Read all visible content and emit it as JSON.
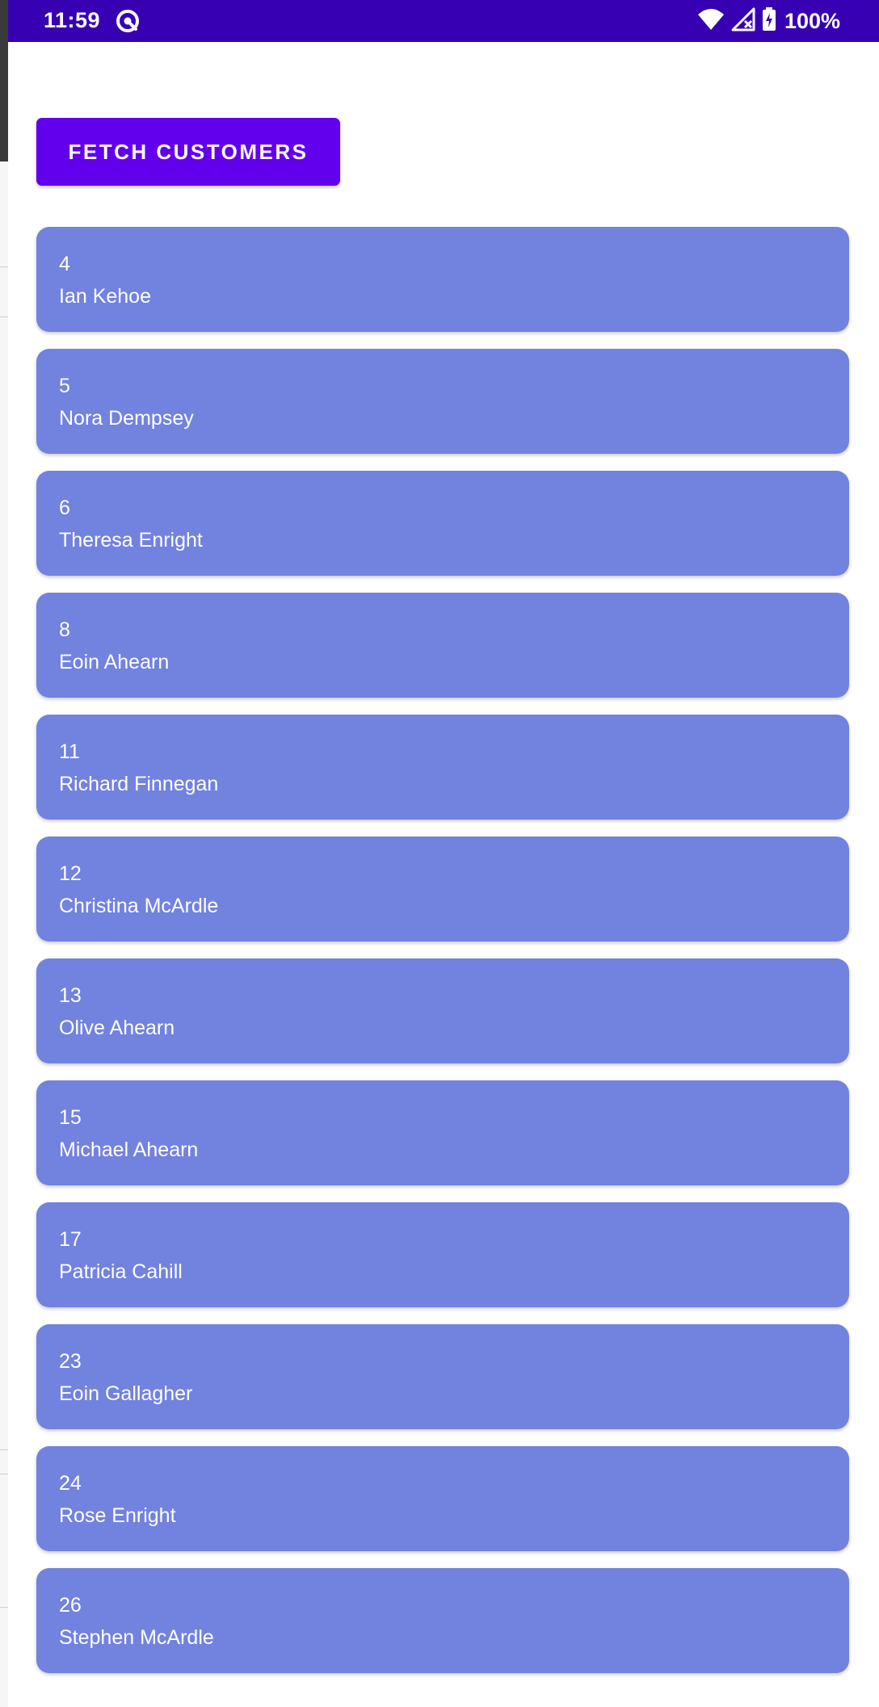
{
  "status_bar": {
    "time": "11:59",
    "left_icon": "sync-icon",
    "wifi_icon": "wifi-icon",
    "signal_icon": "cell-signal-no-service-icon",
    "battery_icon": "battery-charging-icon",
    "battery_text": "100%",
    "background_color": "#3700b3"
  },
  "main": {
    "fetch_button_label": "FETCH CUSTOMERS",
    "button_color": "#6200ee",
    "card_color": "#7282df",
    "customers": [
      {
        "id": "4",
        "name": "Ian Kehoe"
      },
      {
        "id": "5",
        "name": "Nora Dempsey"
      },
      {
        "id": "6",
        "name": "Theresa Enright"
      },
      {
        "id": "8",
        "name": "Eoin Ahearn"
      },
      {
        "id": "11",
        "name": "Richard Finnegan"
      },
      {
        "id": "12",
        "name": "Christina McArdle"
      },
      {
        "id": "13",
        "name": "Olive Ahearn"
      },
      {
        "id": "15",
        "name": "Michael Ahearn"
      },
      {
        "id": "17",
        "name": "Patricia Cahill"
      },
      {
        "id": "23",
        "name": "Eoin Gallagher"
      },
      {
        "id": "24",
        "name": "Rose Enright"
      },
      {
        "id": "26",
        "name": "Stephen McArdle"
      }
    ]
  }
}
